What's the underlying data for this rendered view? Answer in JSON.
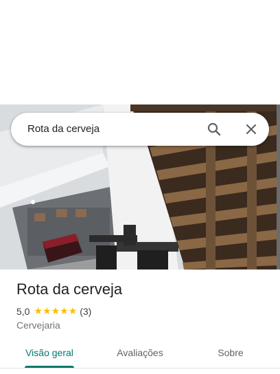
{
  "search": {
    "query": "Rota da cerveja"
  },
  "place": {
    "name": "Rota da cerveja",
    "rating": "5,0",
    "stars": "★★★★★",
    "review_count": "(3)",
    "category": "Cervejaria"
  },
  "tabs": [
    {
      "label": "Visão geral"
    },
    {
      "label": "Avaliações"
    },
    {
      "label": "Sobre"
    }
  ],
  "colors": {
    "accent": "#00796b",
    "star": "#fbbc04"
  }
}
